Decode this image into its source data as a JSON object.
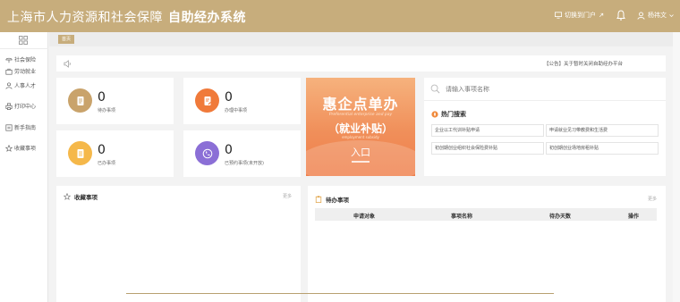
{
  "header": {
    "org_name": "上海市人力资源和社会保障",
    "system_name": "自助经办系统",
    "switch_label": "切换到门户",
    "user_label": "杨祎文"
  },
  "sidebar": {
    "items": [
      {
        "label": "社会保险",
        "icon": "umbrella-icon"
      },
      {
        "label": "劳动就业",
        "icon": "briefcase-icon"
      },
      {
        "label": "人事人才",
        "icon": "person-icon"
      },
      {
        "label": "打印中心",
        "icon": "printer-icon"
      },
      {
        "label": "新手指南",
        "icon": "guide-icon"
      },
      {
        "label": "收藏事项",
        "icon": "star-icon"
      }
    ]
  },
  "tabs": {
    "home": "首页"
  },
  "notice": {
    "text": "【公告】关于暂时关闭自助经办平台"
  },
  "stats": [
    {
      "value": "0",
      "label": "待办事项",
      "color": "#c9a36b"
    },
    {
      "value": "0",
      "label": "办理中事项",
      "color": "#f07a3a"
    },
    {
      "value": "0",
      "label": "已办事项",
      "color": "#f5b84a"
    },
    {
      "value": "0",
      "label": "已预约事项(未开放)",
      "color": "#8b6fd6"
    }
  ],
  "banner": {
    "title": "惠企点单办",
    "english": "Preferential enterprise and pay",
    "subtitle": "（就业补贴）",
    "english2": "employment subsidy",
    "entry": "入口"
  },
  "search": {
    "placeholder": "请输入事项名称"
  },
  "hot": {
    "title": "热门搜索",
    "items": [
      "企业以工代训补贴申请",
      "申请就业见习带教费和生活费",
      "初创期创业组织社会保险费补贴",
      "初创期创业场地房租补贴"
    ]
  },
  "favorites": {
    "title": "收藏事项",
    "more": "更多"
  },
  "todo": {
    "title": "待办事项",
    "more": "更多",
    "columns": [
      "申请对象",
      "事项名称",
      "待办天数",
      "操作"
    ]
  }
}
